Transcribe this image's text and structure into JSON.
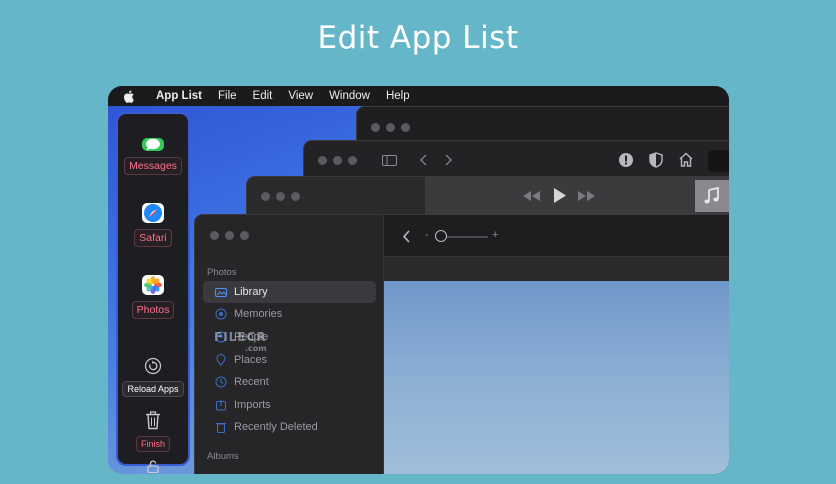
{
  "headline": "Edit App List",
  "menubar": {
    "apple_icon": "apple-logo-icon",
    "app_name": "App List",
    "items": [
      "File",
      "Edit",
      "Window",
      "Help"
    ],
    "view_label": "View"
  },
  "dock": {
    "apps": [
      {
        "label": "Messages",
        "icon": "messages-icon",
        "color": "#34c759"
      },
      {
        "label": "Safari",
        "icon": "safari-icon",
        "color": "#1e88ff"
      },
      {
        "label": "Photos",
        "icon": "photos-icon",
        "color": "#ffffff"
      }
    ],
    "reload_label": "Reload Apps",
    "finish_label": "Finish",
    "accent_color": "#ff6f8a",
    "border_color": "#3b5bd0"
  },
  "photos_window": {
    "section_photos": "Photos",
    "items": [
      {
        "label": "Library",
        "icon": "library-icon",
        "selected": true
      },
      {
        "label": "Memories",
        "icon": "memories-icon",
        "selected": false
      },
      {
        "label": "People",
        "icon": "people-icon",
        "selected": false
      },
      {
        "label": "Places",
        "icon": "places-icon",
        "selected": false
      },
      {
        "label": "Recent",
        "icon": "recent-icon",
        "selected": false
      },
      {
        "label": "Imports",
        "icon": "imports-icon",
        "selected": false
      },
      {
        "label": "Recently Deleted",
        "icon": "trash-icon",
        "selected": false
      }
    ],
    "section_albums": "Albums",
    "zoom_minus": "-",
    "zoom_plus": "+"
  },
  "watermark": {
    "text": "FILECR",
    "sub": ".com"
  }
}
